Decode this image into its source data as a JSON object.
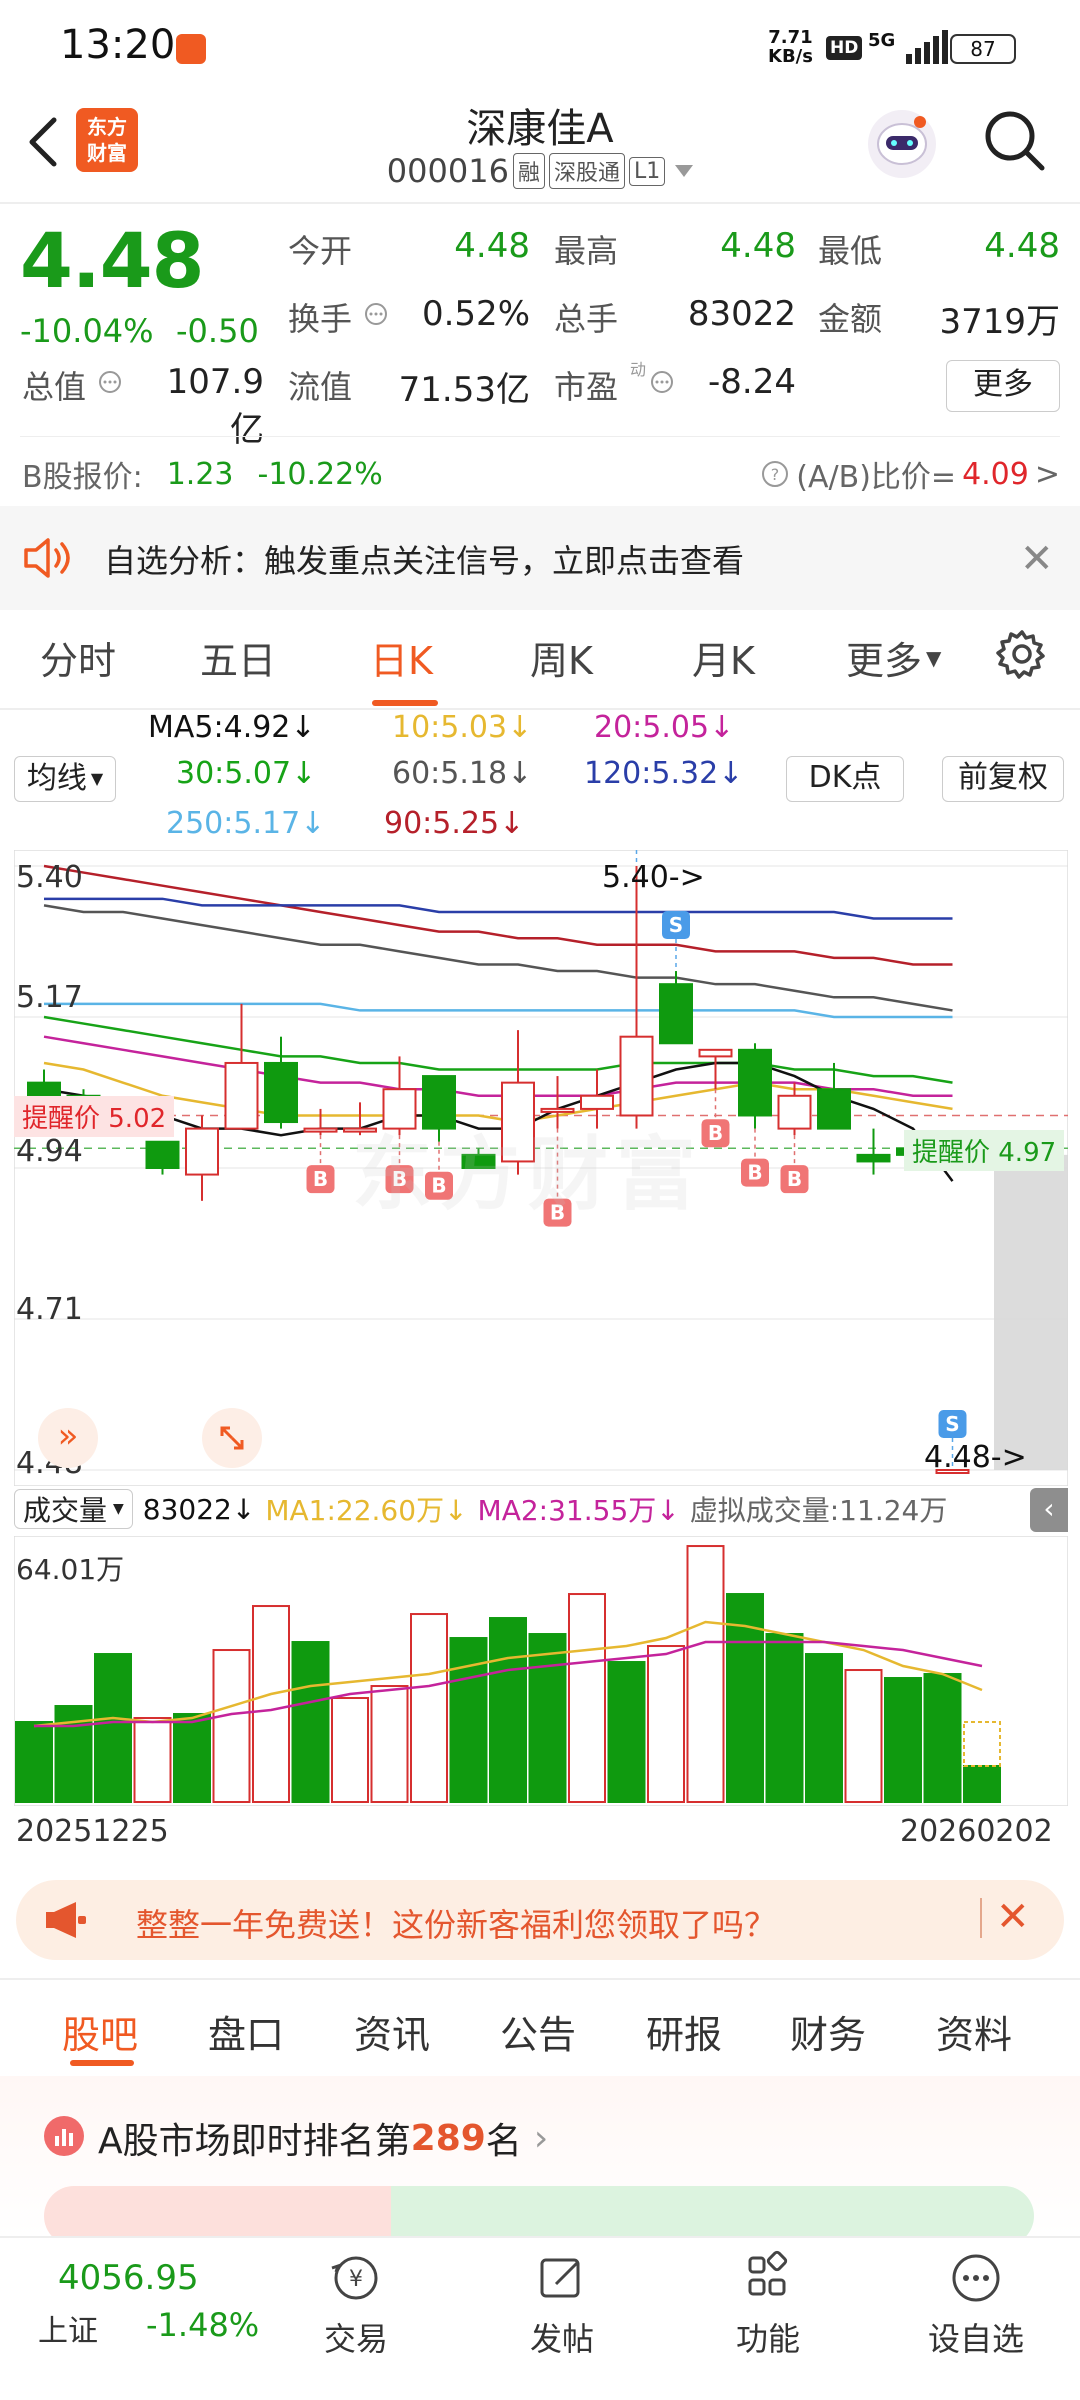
{
  "status_bar": {
    "time": "13:20",
    "net_speed_value": "7.71",
    "net_speed_unit": "KB/s",
    "hd": "HD",
    "signal": "5G",
    "battery": "87"
  },
  "header": {
    "logo_line1": "东方",
    "logo_line2": "财富",
    "stock_name": "深康佳A",
    "stock_code": "000016",
    "tags": [
      "融",
      "深股通",
      "L1"
    ]
  },
  "quote": {
    "price": "4.48",
    "change_pct": "-10.04%",
    "change_amt": "-0.50",
    "fields": [
      {
        "label": "今开",
        "value": "4.48",
        "color": "#1a9a1a"
      },
      {
        "label": "最高",
        "value": "4.48",
        "color": "#1a9a1a"
      },
      {
        "label": "最低",
        "value": "4.48",
        "color": "#1a9a1a"
      },
      {
        "label": "换手",
        "value": "0.52%",
        "color": "#222222"
      },
      {
        "label": "总手",
        "value": "83022",
        "color": "#222222"
      },
      {
        "label": "金额",
        "value": "3719万",
        "color": "#222222"
      },
      {
        "label": "总值",
        "value": "107.9亿",
        "color": "#222222"
      },
      {
        "label": "流值",
        "value": "71.53亿",
        "color": "#222222"
      },
      {
        "label": "市盈",
        "value": "-8.24",
        "color": "#222222"
      }
    ],
    "pe_superscript": "动",
    "more_label": "更多",
    "b_label": "B股报价:",
    "b_price": "1.23",
    "b_change": "-10.22%",
    "ab_label": "(A/B)比价=",
    "ab_value": "4.09"
  },
  "alert": {
    "text": "自选分析：触发重点关注信号，立即点击查看"
  },
  "period_tabs": [
    "分时",
    "五日",
    "日K",
    "周K",
    "月K",
    "更多"
  ],
  "active_period": "日K",
  "ma_legend": {
    "ma5": "MA5:4.92",
    "ma10": "10:5.03",
    "ma20": "20:5.05",
    "ma30": "30:5.07",
    "ma60": "60:5.18",
    "ma120": "120:5.32",
    "ma250": "250:5.17",
    "ma90": "90:5.25",
    "indicator_select": "均线",
    "dk_label": "DK点",
    "fq_label": "前复权"
  },
  "colors": {
    "ma5": "#111111",
    "ma10": "#e6b830",
    "ma20": "#c4239b",
    "ma30": "#17a317",
    "ma60": "#555555",
    "ma120": "#2a3ea8",
    "ma250": "#5ab4e6",
    "ma90": "#b5202a",
    "up": "#d62f2f",
    "down": "#0f9a0f",
    "accent": "#f05a22"
  },
  "kline": {
    "price_max_label": "5.40",
    "high_callout": "5.40->",
    "low_callout": "4.48->",
    "remind_upper_label": "提醒价 5.02",
    "remind_lower_label": "提醒价 4.97",
    "watermark": "东方财富",
    "y_ticks": [
      "5.40",
      "5.17",
      "4.94",
      "4.71",
      "4.48"
    ],
    "buy_marker": "B",
    "sell_marker": "S"
  },
  "chart_data": {
    "type": "candlestick",
    "y_range": [
      4.48,
      5.4
    ],
    "x_start_label": "20251225",
    "x_end_label": "20260202",
    "candles": [
      {
        "o": 5.07,
        "h": 5.09,
        "l": 5.05,
        "c": 5.05
      },
      {
        "o": 5.05,
        "h": 5.06,
        "l": 5.03,
        "c": 5.04
      },
      {
        "o": 5.02,
        "h": 5.03,
        "l": 4.99,
        "c": 4.99
      },
      {
        "o": 4.98,
        "h": 4.98,
        "l": 4.93,
        "c": 4.94
      },
      {
        "o": 4.93,
        "h": 5.02,
        "l": 4.89,
        "c": 5.0
      },
      {
        "o": 5.0,
        "h": 5.19,
        "l": 5.0,
        "c": 5.1
      },
      {
        "o": 5.1,
        "h": 5.14,
        "l": 5.0,
        "c": 5.01
      },
      {
        "o": 5.0,
        "h": 5.03,
        "l": 4.99,
        "c": 5.0
      },
      {
        "o": 5.0,
        "h": 5.04,
        "l": 4.99,
        "c": 5.0
      },
      {
        "o": 5.0,
        "h": 5.11,
        "l": 4.99,
        "c": 5.06
      },
      {
        "o": 5.08,
        "h": 5.08,
        "l": 4.98,
        "c": 5.0
      },
      {
        "o": 4.96,
        "h": 4.97,
        "l": 4.94,
        "c": 4.94
      },
      {
        "o": 4.95,
        "h": 5.15,
        "l": 4.93,
        "c": 5.07
      },
      {
        "o": 5.03,
        "h": 5.08,
        "l": 5.0,
        "c": 5.03
      },
      {
        "o": 5.03,
        "h": 5.09,
        "l": 5.0,
        "c": 5.05
      },
      {
        "o": 5.02,
        "h": 5.4,
        "l": 5.0,
        "c": 5.14
      },
      {
        "o": 5.22,
        "h": 5.24,
        "l": 5.14,
        "c": 5.13
      },
      {
        "o": 5.11,
        "h": 5.12,
        "l": 5.06,
        "c": 5.12
      },
      {
        "o": 5.12,
        "h": 5.13,
        "l": 5.0,
        "c": 5.02
      },
      {
        "o": 5.0,
        "h": 5.07,
        "l": 4.99,
        "c": 5.05
      },
      {
        "o": 5.06,
        "h": 5.1,
        "l": 5.0,
        "c": 5.0
      },
      {
        "o": 4.96,
        "h": 5.0,
        "l": 4.93,
        "c": 4.95
      },
      {
        "o": 4.97,
        "h": 4.97,
        "l": 4.94,
        "c": 4.96
      },
      {
        "o": 4.48,
        "h": 4.48,
        "l": 4.48,
        "c": 4.48
      }
    ],
    "ma5": [
      5.06,
      5.05,
      5.04,
      5.02,
      5.0,
      5.0,
      4.99,
      5.0,
      5.0,
      5.02,
      5.02,
      5.0,
      5.0,
      5.03,
      5.05,
      5.07,
      5.09,
      5.1,
      5.1,
      5.08,
      5.05,
      5.03,
      5.0,
      4.92
    ],
    "ma10": [
      5.1,
      5.09,
      5.07,
      5.05,
      5.04,
      5.03,
      5.02,
      5.02,
      5.02,
      5.02,
      5.02,
      5.02,
      5.01,
      5.02,
      5.03,
      5.04,
      5.05,
      5.06,
      5.07,
      5.06,
      5.06,
      5.05,
      5.04,
      5.03
    ],
    "ma20": [
      5.14,
      5.13,
      5.12,
      5.11,
      5.1,
      5.09,
      5.08,
      5.07,
      5.07,
      5.06,
      5.06,
      5.05,
      5.05,
      5.05,
      5.05,
      5.06,
      5.07,
      5.07,
      5.07,
      5.07,
      5.06,
      5.06,
      5.05,
      5.05
    ],
    "ma30": [
      5.17,
      5.16,
      5.15,
      5.14,
      5.13,
      5.12,
      5.11,
      5.11,
      5.1,
      5.1,
      5.09,
      5.09,
      5.09,
      5.09,
      5.09,
      5.1,
      5.1,
      5.1,
      5.1,
      5.09,
      5.09,
      5.08,
      5.08,
      5.07
    ],
    "ma60": [
      5.34,
      5.33,
      5.33,
      5.32,
      5.31,
      5.3,
      5.29,
      5.28,
      5.28,
      5.27,
      5.26,
      5.25,
      5.25,
      5.24,
      5.24,
      5.23,
      5.23,
      5.22,
      5.22,
      5.21,
      5.2,
      5.2,
      5.19,
      5.18
    ],
    "ma120": [
      5.35,
      5.35,
      5.35,
      5.35,
      5.34,
      5.34,
      5.34,
      5.34,
      5.34,
      5.34,
      5.33,
      5.33,
      5.33,
      5.33,
      5.33,
      5.33,
      5.33,
      5.33,
      5.33,
      5.33,
      5.33,
      5.32,
      5.32,
      5.32
    ],
    "ma250": [
      5.19,
      5.19,
      5.19,
      5.19,
      5.19,
      5.19,
      5.19,
      5.19,
      5.18,
      5.18,
      5.18,
      5.18,
      5.18,
      5.18,
      5.18,
      5.18,
      5.18,
      5.18,
      5.18,
      5.18,
      5.17,
      5.17,
      5.17,
      5.17
    ],
    "ma90": [
      5.4,
      5.39,
      5.38,
      5.37,
      5.36,
      5.35,
      5.34,
      5.33,
      5.32,
      5.31,
      5.3,
      5.3,
      5.29,
      5.29,
      5.28,
      5.28,
      5.28,
      5.27,
      5.27,
      5.27,
      5.26,
      5.26,
      5.25,
      5.25
    ],
    "buy_signals": [
      7,
      9,
      10,
      13,
      17,
      18,
      19
    ],
    "sell_signals": [
      15,
      16,
      23
    ],
    "remind_upper": 5.02,
    "remind_lower": 4.97,
    "volume": {
      "max_label": "64.01万",
      "max": 64.01,
      "values": [
        20,
        24,
        37,
        21,
        22,
        38,
        49,
        40,
        26,
        29,
        47,
        41,
        46,
        42,
        52,
        35,
        39,
        64,
        52,
        42,
        37,
        33,
        31,
        32,
        9
      ],
      "up_flags": [
        0,
        0,
        0,
        1,
        0,
        1,
        1,
        0,
        1,
        1,
        1,
        0,
        0,
        0,
        1,
        0,
        1,
        1,
        0,
        0,
        0,
        1,
        0,
        0,
        0
      ],
      "ma1": [
        19,
        20,
        21,
        20,
        21,
        24,
        27,
        29,
        30,
        31,
        32,
        34,
        36,
        37,
        38,
        39,
        41,
        45,
        44,
        42,
        40,
        38,
        34,
        32,
        28
      ],
      "ma2": [
        19,
        19,
        20,
        20,
        20,
        22,
        23,
        25,
        27,
        28,
        29,
        31,
        33,
        34,
        35,
        36,
        37,
        40,
        40,
        40,
        40,
        39,
        38,
        36,
        34
      ]
    }
  },
  "volume_legend": {
    "select": "成交量",
    "vol": "83022",
    "ma1": "MA1:22.60万",
    "ma2": "MA2:31.55万",
    "virtual": "虚拟成交量:11.24万"
  },
  "x_axis": {
    "start": "20251225",
    "end": "20260202"
  },
  "promo": {
    "text": "整整一年免费送！这份新客福利您领取了吗？"
  },
  "bottom_tabs": [
    "股吧",
    "盘口",
    "资讯",
    "公告",
    "研报",
    "财务",
    "资料"
  ],
  "active_bottom_tab": "股吧",
  "rank": {
    "prefix": "A股市场即时排名第",
    "number": "289",
    "suffix": "名"
  },
  "bottom_nav": {
    "index_value": "4056.95",
    "index_name": "上证",
    "index_pct": "-1.48%",
    "items": [
      "交易",
      "发帖",
      "功能",
      "设自选"
    ]
  }
}
